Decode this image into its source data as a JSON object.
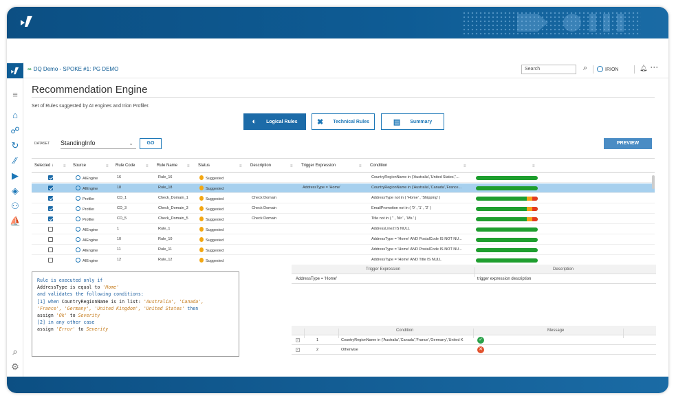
{
  "colors": {
    "brand": "#0e5c95",
    "accent": "#1c77b7",
    "suggested": "#f3a712",
    "ok": "#2aa24a",
    "error": "#e2512d"
  },
  "topbar": {
    "breadcrumb": "DQ Demo - SPOKE #1: PG DEMO",
    "search_placeholder": "Search",
    "user": "IRION"
  },
  "sidebar": {
    "items": [
      "home-icon",
      "connections-icon",
      "sync-icon",
      "rules-icon",
      "pipeline-icon",
      "eye-icon",
      "users-icon",
      "ship-icon"
    ],
    "bottom": [
      "search-icon",
      "settings-icon"
    ]
  },
  "page": {
    "title": "Recommendation Engine",
    "subtitle": "Set of Rules suggested by AI engines and Irion Profiler.",
    "tabs": [
      {
        "label": "Logical Rules",
        "icon": "brain-icon",
        "active": true
      },
      {
        "label": "Technical Rules",
        "icon": "tools-icon",
        "active": false
      },
      {
        "label": "Summary",
        "icon": "document-icon",
        "active": false
      }
    ],
    "dataset_label": "DATASET",
    "dataset_value": "StandingInfo",
    "go_label": "GO",
    "preview_label": "PREVIEW"
  },
  "grid": {
    "headers": [
      "Selected",
      "Source",
      "Rule Code",
      "Rule Name",
      "Status",
      "Description",
      "Trigger Expression",
      "Condition"
    ],
    "rows": [
      {
        "selected": true,
        "source": "AIEngine",
        "code": "16",
        "name": "Rule_16",
        "status": "Suggested",
        "description": "",
        "trigger": "",
        "condition": "CountryRegionName in ('Australia','United States','...",
        "bar": "ok"
      },
      {
        "selected": true,
        "source": "AIEngine",
        "code": "18",
        "name": "Rule_18",
        "status": "Suggested",
        "description": "",
        "trigger": "AddressType = 'Home'",
        "condition": "CountryRegionName in ('Australia','Canada','France...",
        "bar": "ok",
        "highlight": true
      },
      {
        "selected": true,
        "source": "Profiler",
        "code": "CD_1",
        "name": "Check_Domain_1",
        "status": "Suggested",
        "description": "Check Domain",
        "trigger": "",
        "condition": "AddressType not in ( 'Home' , 'Shipping' )",
        "bar": "warn"
      },
      {
        "selected": true,
        "source": "Profiler",
        "code": "CD_3",
        "name": "Check_Domain_3",
        "status": "Suggested",
        "description": "Check Domain",
        "trigger": "",
        "condition": "EmailPromotion not in ( '0' , '1' , '2' )",
        "bar": "warn"
      },
      {
        "selected": true,
        "source": "Profiler",
        "code": "CD_5",
        "name": "Check_Domain_5",
        "status": "Suggested",
        "description": "Check Domain",
        "trigger": "",
        "condition": "Title not in ( '' , 'Mr.' , 'Ms.' )",
        "bar": "warn"
      },
      {
        "selected": false,
        "source": "AIEngine",
        "code": "1",
        "name": "Rule_1",
        "status": "Suggested",
        "description": "",
        "trigger": "",
        "condition": "AddressLine2 IS NULL",
        "bar": "ok"
      },
      {
        "selected": false,
        "source": "AIEngine",
        "code": "10",
        "name": "Rule_10",
        "status": "Suggested",
        "description": "",
        "trigger": "",
        "condition": "AddressType = 'Home' AND PostalCode IS NOT NU...",
        "bar": "ok"
      },
      {
        "selected": false,
        "source": "AIEngine",
        "code": "11",
        "name": "Rule_11",
        "status": "Suggested",
        "description": "",
        "trigger": "",
        "condition": "AddressType = 'Home' AND PostalCode IS NOT NU...",
        "bar": "ok"
      },
      {
        "selected": false,
        "source": "AIEngine",
        "code": "12",
        "name": "Rule_12",
        "status": "Suggested",
        "description": "",
        "trigger": "",
        "condition": "AddressType = 'Home' AND Title IS NULL",
        "bar": "ok"
      }
    ]
  },
  "rule_text": {
    "l1": "Rule is executed only if",
    "l2a": "AddressType",
    "l2b": " is equal to ",
    "l2c": "'Home'",
    "l3": "and validates the following conditions:",
    "l4a": "[1] when ",
    "l4b": "CountryRegionName",
    "l4c": " is in list: ",
    "l4d": "'Australia', 'Canada',",
    "l5a": "'France', 'Germany', 'United Kingdom', 'United States'",
    "l5b": " then",
    "l6a": "assign ",
    "l6b": "'Ok'",
    "l6c": " to ",
    "l6d": "Severity",
    "l7": "[2] in any other case",
    "l8a": "assign ",
    "l8b": "'Error'",
    "l8c": " to ",
    "l8d": "Severity"
  },
  "trigger_table": {
    "headers": [
      "Trigger Expression",
      "Description"
    ],
    "row": [
      "AddressType = 'Home'",
      "trigger expression description"
    ]
  },
  "condition_table": {
    "headers": [
      "Condition",
      "Message"
    ],
    "rows": [
      {
        "num": "1",
        "condition": "CountryRegionName in ('Australia','Canada','France','Germany','United K",
        "result": "ok"
      },
      {
        "num": "2",
        "condition": "Otherwise",
        "result": "error"
      }
    ]
  }
}
